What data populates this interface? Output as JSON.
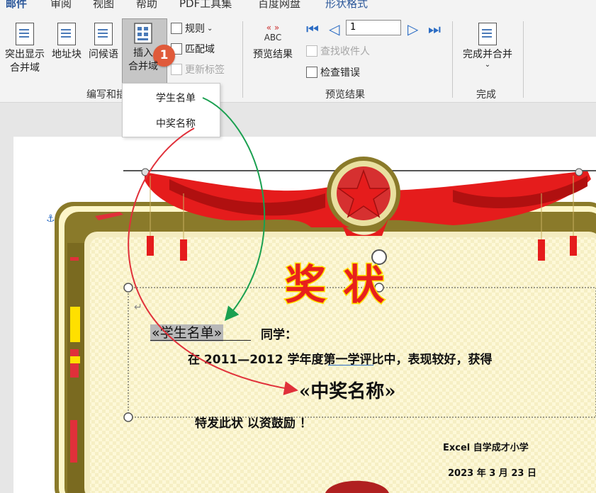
{
  "tabs": [
    "邮件",
    "审阅",
    "视图",
    "帮助",
    "PDF工具集",
    "百度网盘",
    "形状格式"
  ],
  "ribbon": {
    "highlight_merge": "突出显示\n合并域",
    "address_block": "地址块",
    "greeting": "问候语",
    "insert_field_line1": "插入",
    "insert_field_line2": "合并域",
    "rules": "规则",
    "match_fields": "匹配域",
    "update_labels": "更新标签",
    "preview_results": "预览结果",
    "abc": "ABC",
    "record_number": "1",
    "find_recipient": "查找收件人",
    "check_errors": "检查错误",
    "finish_merge": "完成并合并",
    "group_write_insert": "编写和插",
    "group_preview": "预览结果",
    "group_finish": "完成"
  },
  "badge": "1",
  "dropdown": {
    "items": [
      "学生名单",
      "中奖名称"
    ]
  },
  "certificate": {
    "title": "奖  状",
    "field_student": "«学生名单»",
    "classmate": "同学：",
    "body_line": "在 2011—2012 学年度第一学评比中，表现较好，获得",
    "field_award": "«中奖名称»",
    "special": "特发此状    以资鼓励 ！",
    "school": "Excel 自学成才小学",
    "date": "2023 年 3 月 23 日"
  },
  "colors": {
    "accent": "#2b579a",
    "badge": "#e05a3a",
    "green_arrow": "#1aa050",
    "red_arrow": "#e0303a",
    "title_red": "#e8201c",
    "title_yellow": "#ffe000",
    "frame_olive": "#8a7a2a",
    "paper_yellow": "#fdf8d8"
  }
}
